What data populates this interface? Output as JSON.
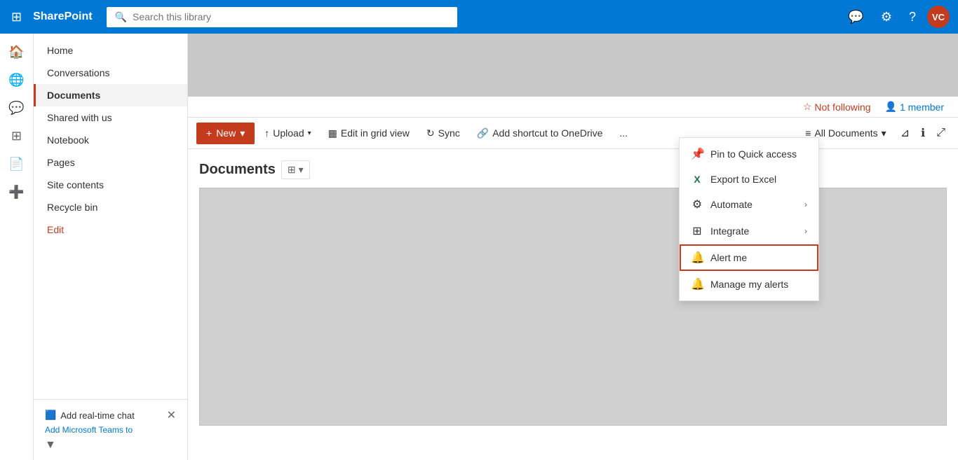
{
  "app": {
    "name": "SharePoint"
  },
  "topbar": {
    "search_placeholder": "Search this library",
    "avatar_initials": "VC"
  },
  "meta": {
    "following_label": "Not following",
    "member_label": "1 member"
  },
  "toolbar": {
    "new_label": "New",
    "upload_label": "Upload",
    "edit_grid_label": "Edit in grid view",
    "sync_label": "Sync",
    "shortcut_label": "Add shortcut to OneDrive",
    "more_label": "...",
    "all_docs_label": "All Documents",
    "filter_label": "Filter",
    "info_label": "Info",
    "fullscreen_label": "Fullscreen"
  },
  "sidebar": {
    "items": [
      {
        "label": "Home",
        "active": false
      },
      {
        "label": "Conversations",
        "active": false
      },
      {
        "label": "Documents",
        "active": true
      },
      {
        "label": "Shared with us",
        "active": false
      },
      {
        "label": "Notebook",
        "active": false
      },
      {
        "label": "Pages",
        "active": false
      },
      {
        "label": "Site contents",
        "active": false
      },
      {
        "label": "Recycle bin",
        "active": false
      },
      {
        "label": "Edit",
        "active": false,
        "orange": true
      }
    ]
  },
  "chat_widget": {
    "title": "Add real-time chat",
    "subtitle": "Add Microsoft Teams to"
  },
  "docs": {
    "title": "Documents"
  },
  "dropdown": {
    "items": [
      {
        "id": "pin",
        "label": "Pin to Quick access",
        "icon": "📌",
        "has_sub": false
      },
      {
        "id": "export",
        "label": "Export to Excel",
        "icon": "📊",
        "has_sub": false
      },
      {
        "id": "automate",
        "label": "Automate",
        "icon": "⚙",
        "has_sub": true
      },
      {
        "id": "integrate",
        "label": "Integrate",
        "icon": "🔗",
        "has_sub": true
      },
      {
        "id": "alert",
        "label": "Alert me",
        "icon": "🔔",
        "has_sub": false,
        "highlighted": true
      },
      {
        "id": "manage",
        "label": "Manage my alerts",
        "icon": "🔔",
        "has_sub": false
      }
    ]
  }
}
